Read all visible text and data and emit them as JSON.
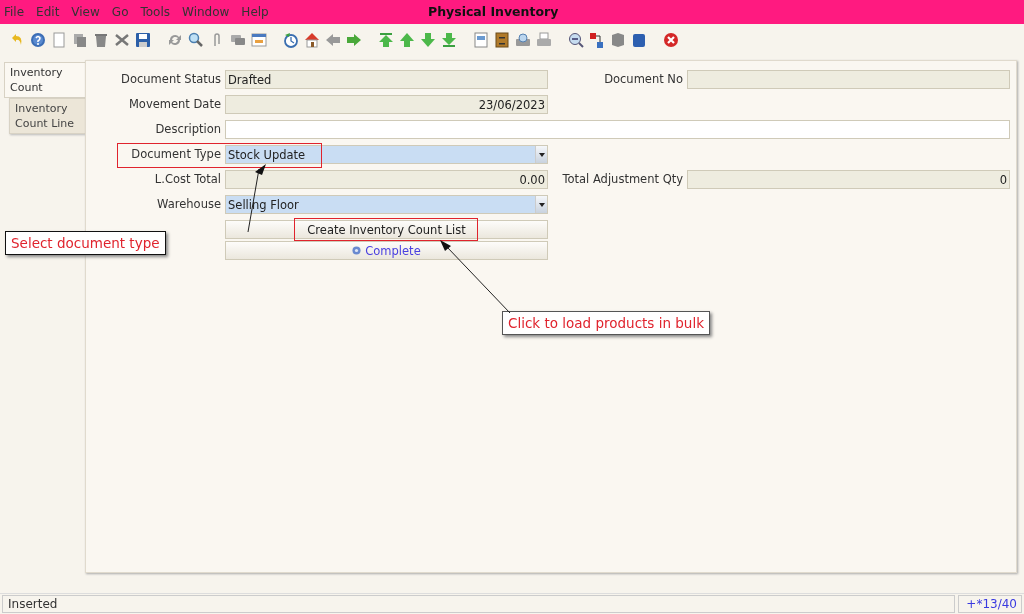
{
  "menu": [
    "File",
    "Edit",
    "View",
    "Go",
    "Tools",
    "Window",
    "Help"
  ],
  "window": {
    "title": "Physical Inventory"
  },
  "tabs": [
    {
      "label": "Inventory Count",
      "selected": true
    },
    {
      "label": "Inventory Count Line",
      "selected": false
    }
  ],
  "rows": [
    {
      "left": {
        "label": "Document Status",
        "value": "Drafted",
        "kind": "readonly"
      },
      "right": {
        "label": "Document No",
        "kind": "readonly"
      }
    },
    {
      "left": {
        "label": "Movement Date",
        "value": "23/06/2023",
        "kind": "number"
      }
    },
    {
      "left": {
        "label": "Description",
        "kind": "input"
      }
    },
    {
      "left": {
        "label": "Document Type",
        "value": "Stock Update",
        "kind": "combo"
      }
    },
    {
      "left": {
        "label": "L.Cost Total",
        "value": "0.00",
        "kind": "number"
      },
      "right": {
        "label": "Total Adjustment Qty",
        "value": "0",
        "kind": "number"
      }
    },
    {
      "left": {
        "label": "Warehouse",
        "value": "Selling Floor",
        "kind": "combo"
      }
    }
  ],
  "buttons": [
    {
      "label": "Create Inventory Count List",
      "kind": "plain"
    },
    {
      "label": "Complete",
      "kind": "process"
    }
  ],
  "callouts": [
    {
      "text": "Select document type"
    },
    {
      "text": "Click to load products in bulk"
    }
  ],
  "status_bar": {
    "message": "Inserted",
    "record": "+*13/40"
  }
}
